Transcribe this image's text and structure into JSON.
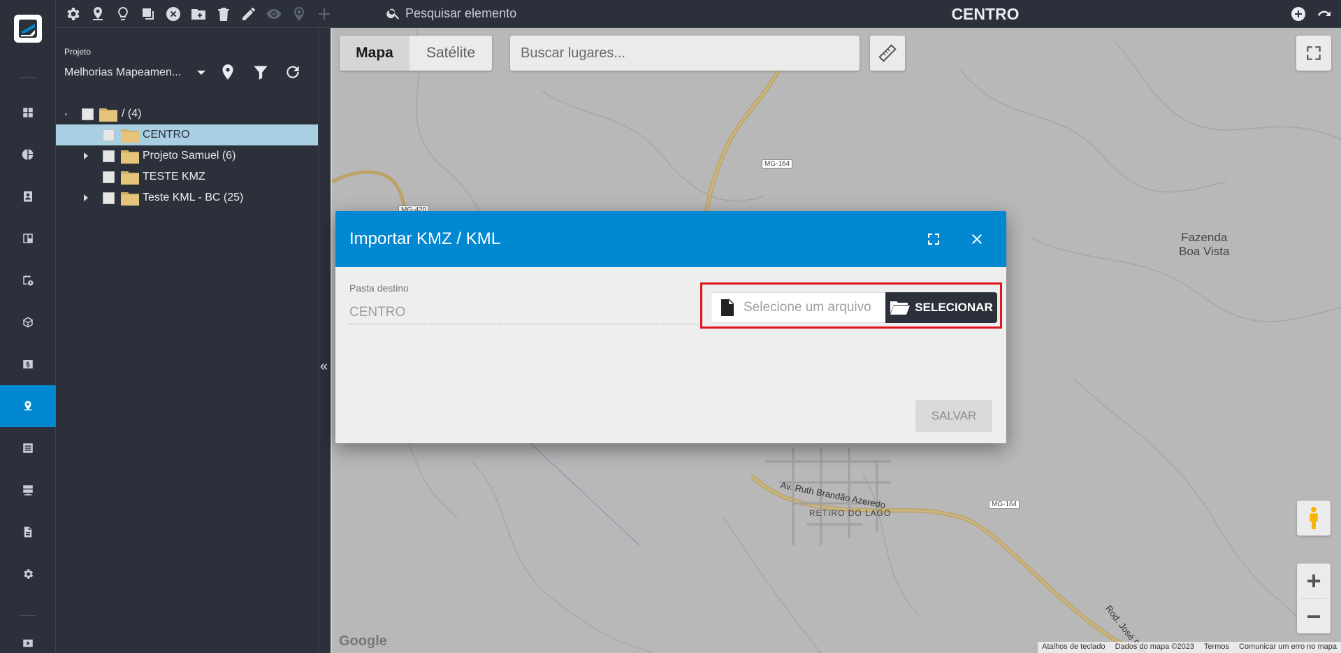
{
  "topbar": {
    "search_placeholder": "Pesquisar elemento",
    "title": "CENTRO",
    "tools": [
      "gear-icon",
      "map-marker-icon",
      "lightbulb-icon",
      "copy-icon",
      "close-circle-icon",
      "folder-plus-icon",
      "trash-icon",
      "pencil-icon",
      "eye-icon",
      "location-icon",
      "plus-icon"
    ]
  },
  "sidebar": {
    "items": [
      "dashboard",
      "charts",
      "contacts",
      "board",
      "calendar",
      "box",
      "finance",
      "map",
      "list",
      "servers",
      "document",
      "settings",
      "video"
    ],
    "active": "map"
  },
  "project": {
    "label": "Projeto",
    "selected": "Melhorias Mapeamen..."
  },
  "tree": {
    "root": "/ (4)",
    "items": [
      {
        "label": "CENTRO",
        "selected": true,
        "expandable": false
      },
      {
        "label": "Projeto Samuel (6)",
        "selected": false,
        "expandable": true
      },
      {
        "label": "TESTE KMZ",
        "selected": false,
        "expandable": false
      },
      {
        "label": "Teste KML - BC (25)",
        "selected": false,
        "expandable": true
      }
    ]
  },
  "map": {
    "type_options": [
      "Mapa",
      "Satélite"
    ],
    "type_selected": "Mapa",
    "search_placeholder": "Buscar lugares...",
    "labels": {
      "place_1": "Fazenda",
      "place_2": "Boa Vista",
      "district": "RETIRO DO LAGO",
      "avenue": "Av. Ruth Brandão Azeredo",
      "road": "Rod. José Roberto P.",
      "road_tag_1": "MG-164",
      "road_tag_2": "MG-164",
      "road_tag_3": "MG-420"
    },
    "logo": "Google",
    "attribution": [
      "Atalhos de teclado",
      "Dados do mapa ©2023",
      "Termos",
      "Comunicar um erro no mapa"
    ]
  },
  "modal": {
    "title": "Importar KMZ / KML",
    "field_label": "Pasta destino",
    "field_value": "CENTRO",
    "file_placeholder": "Selecione um arquivo",
    "select_button": "SELECIONAR",
    "save_button": "SALVAR",
    "header_color": "#0288d1",
    "highlight_color": "#e0141d"
  }
}
